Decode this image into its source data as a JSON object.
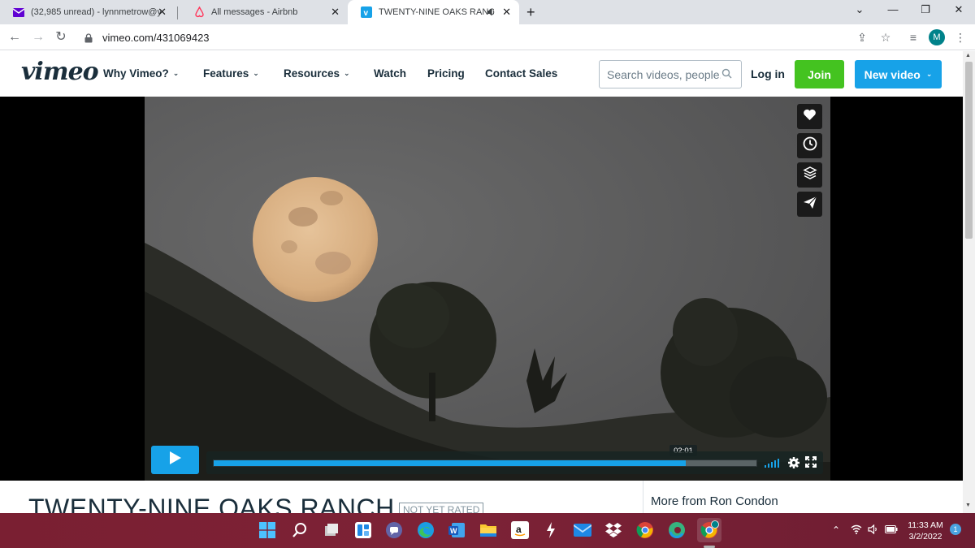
{
  "browser": {
    "tabs": [
      {
        "title": "(32,985 unread) - lynnmetrow@y",
        "icon": "yahoo-mail-icon",
        "active": false
      },
      {
        "title": "All messages - Airbnb",
        "icon": "airbnb-icon",
        "active": false
      },
      {
        "title": "TWENTY-NINE OAKS RANCH",
        "icon": "vimeo-icon",
        "active": true
      }
    ],
    "close_glyph": "✕",
    "new_tab_glyph": "+",
    "url": "vimeo.com/431069423",
    "profile_initial": "M"
  },
  "vimeo_header": {
    "logo": "vimeo",
    "nav": [
      {
        "label": "Why Vimeo?",
        "dropdown": true
      },
      {
        "label": "Features",
        "dropdown": true
      },
      {
        "label": "Resources",
        "dropdown": true
      },
      {
        "label": "Watch",
        "dropdown": false
      },
      {
        "label": "Pricing",
        "dropdown": false
      },
      {
        "label": "Contact Sales",
        "dropdown": false
      }
    ],
    "search_placeholder": "Search videos, people...",
    "login_label": "Log in",
    "join_label": "Join",
    "new_video_label": "New video"
  },
  "player": {
    "side_actions": [
      "like-icon",
      "watch-later-icon",
      "collections-icon",
      "share-icon"
    ],
    "timecode": "02:01",
    "progress_fraction": 0.87,
    "volume_level": 5,
    "controls": [
      "settings-icon",
      "fullscreen-icon"
    ]
  },
  "video_info": {
    "title": "TWENTY-NINE OAKS RANCH",
    "rating": "NOT YET RATED",
    "more_from": "More from Ron Condon"
  },
  "taskbar": {
    "apps": [
      "windows-start-icon",
      "search-icon",
      "task-view-icon",
      "widgets-icon",
      "teams-chat-icon",
      "edge-icon",
      "word-icon",
      "file-explorer-icon",
      "amazon-icon",
      "bolt-app-icon",
      "mail-icon",
      "dropbox-icon",
      "chrome-icon",
      "edge-beta-icon",
      "chrome-profile-icon"
    ],
    "time": "11:33 AM",
    "date": "3/2/2022",
    "notification_count": "1"
  },
  "colors": {
    "vimeo_blue": "#17a2e8",
    "join_green": "#44c320",
    "vimeo_text": "#1a2e3b",
    "taskbar": "#7a1f32"
  }
}
